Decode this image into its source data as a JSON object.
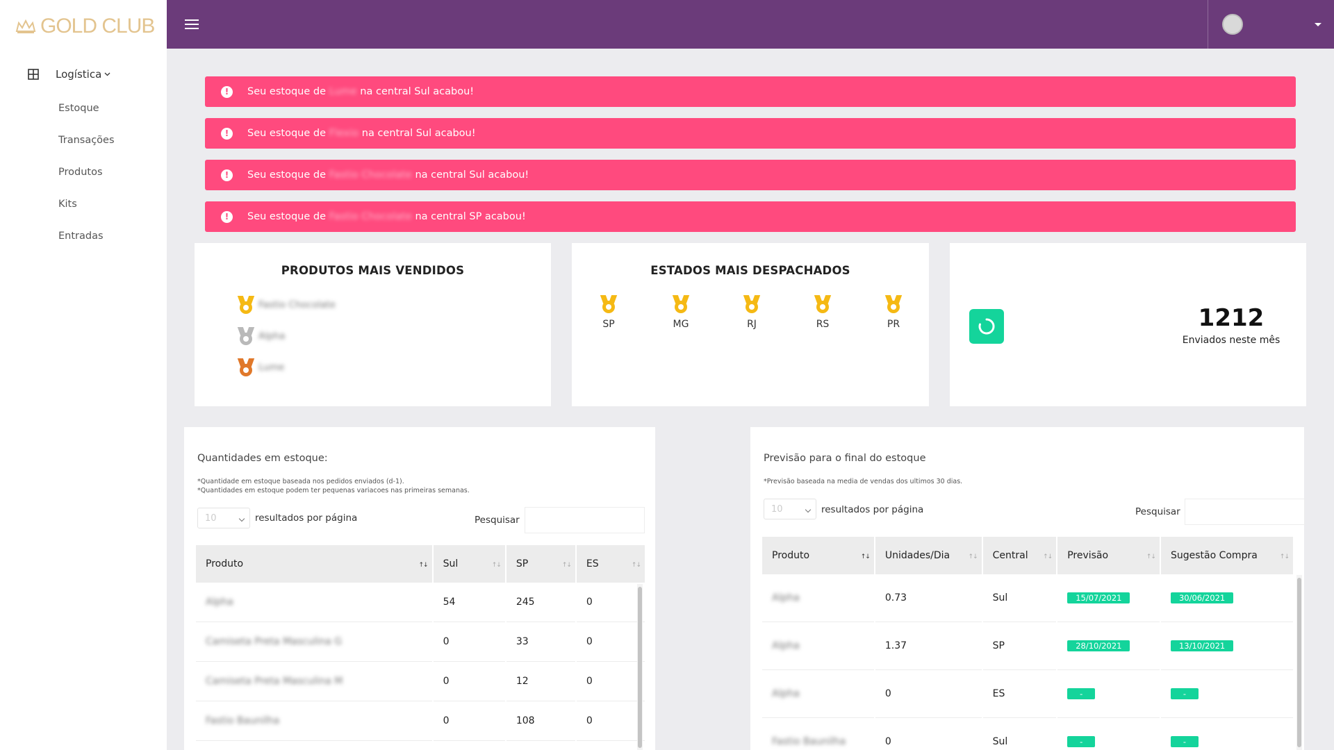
{
  "logo": {
    "text": "GOLD CLUB"
  },
  "sidebar": {
    "group_label": "Logística",
    "items": [
      {
        "label": "Estoque"
      },
      {
        "label": "Transações"
      },
      {
        "label": "Produtos"
      },
      {
        "label": "Kits"
      },
      {
        "label": "Entradas"
      }
    ]
  },
  "alerts": [
    {
      "prefix": "Seu estoque de",
      "product": "Lume",
      "suffix": "na central Sul acabou!"
    },
    {
      "prefix": "Seu estoque de",
      "product": "Flexio",
      "suffix": "na central Sul acabou!"
    },
    {
      "prefix": "Seu estoque de",
      "product": "Fastio Chocolate",
      "suffix": "na central Sul acabou!"
    },
    {
      "prefix": "Seu estoque de",
      "product": "Fastio Chocolate",
      "suffix": "na central SP acabou!"
    }
  ],
  "top_products": {
    "title": "PRODUTOS MAIS VENDIDOS",
    "items": [
      {
        "name": "Fastio Chocolate",
        "medal": "gold"
      },
      {
        "name": "Alpha",
        "medal": "silver"
      },
      {
        "name": "Lume",
        "medal": "bronze"
      }
    ]
  },
  "top_states": {
    "title": "ESTADOS MAIS DESPACHADOS",
    "items": [
      "SP",
      "MG",
      "RJ",
      "RS",
      "PR"
    ]
  },
  "shipped": {
    "value": "1212",
    "label": "Enviados neste mês",
    "icon": "spinner-icon",
    "icon_color": "#14d49b"
  },
  "stock_table": {
    "title": "Quantidades em estoque:",
    "note1": "*Quantidade em estoque baseada nos pedidos enviados (d-1).",
    "note2": "*Quantidades em estoque podem ter pequenas variacoes nas primeiras semanas.",
    "page_size": "10",
    "per_page_label": "resultados por página",
    "search_label": "Pesquisar",
    "columns": [
      "Produto",
      "Sul",
      "SP",
      "ES"
    ],
    "rows": [
      [
        "Alpha",
        "54",
        "245",
        "0"
      ],
      [
        "Camiseta Preta Masculina G",
        "0",
        "33",
        "0"
      ],
      [
        "Camiseta Preta Masculina M",
        "0",
        "12",
        "0"
      ],
      [
        "Fastio Baunilha",
        "0",
        "108",
        "0"
      ]
    ]
  },
  "forecast_table": {
    "title": "Previsão para o final do estoque",
    "note": "*Previsão baseada na media de vendas dos ultimos 30 dias.",
    "page_size": "10",
    "per_page_label": "resultados por página",
    "search_label": "Pesquisar",
    "columns": [
      "Produto",
      "Unidades/Dia",
      "Central",
      "Previsão",
      "Sugestão Compra"
    ],
    "rows": [
      [
        "Alpha",
        "0.73",
        "Sul",
        "15/07/2021",
        "30/06/2021"
      ],
      [
        "Alpha",
        "1.37",
        "SP",
        "28/10/2021",
        "13/10/2021"
      ],
      [
        "Alpha",
        "0",
        "ES",
        "-",
        "-"
      ],
      [
        "Fastio Baunilha",
        "0",
        "Sul",
        "-",
        "-"
      ]
    ]
  },
  "colors": {
    "topbar": "#6b3b7a",
    "alert": "#ff4a7e",
    "accent": "#14d49b",
    "logo": "#e3c48f"
  }
}
